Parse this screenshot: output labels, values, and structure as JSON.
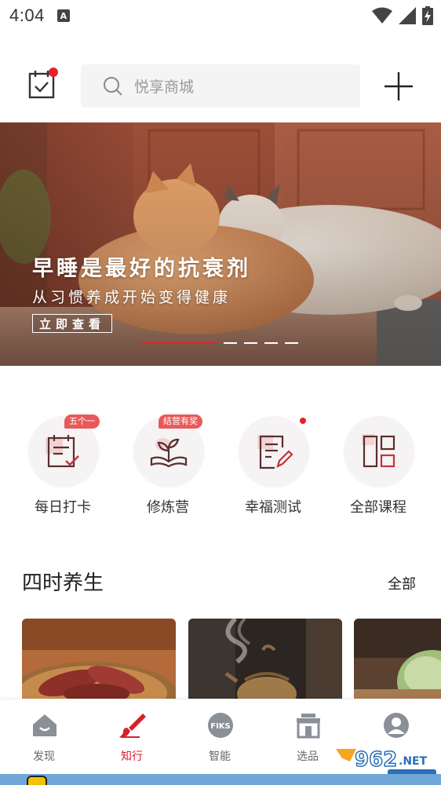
{
  "status_bar": {
    "time": "4:04",
    "notification_icon": "a-icon",
    "icons": [
      "wifi-icon",
      "signal-icon",
      "battery-charging-icon"
    ]
  },
  "top_bar": {
    "calendar_icon": "calendar-check-icon",
    "search_placeholder": "悦享商城",
    "add_icon": "plus-icon"
  },
  "banner": {
    "title": "早睡是最好的抗衰剂",
    "subtitle": "从习惯养成开始变得健康",
    "cta_label": "立即查看",
    "slide_count": 5,
    "active_slide": 1
  },
  "quick_entries": [
    {
      "label": "每日打卡",
      "icon": "calendar-checkin-icon",
      "badge": "五个一",
      "dot": false
    },
    {
      "label": "修炼营",
      "icon": "sprout-book-icon",
      "badge": "结营有奖",
      "dot": false
    },
    {
      "label": "幸福测试",
      "icon": "test-edit-icon",
      "badge": "",
      "dot": true
    },
    {
      "label": "全部课程",
      "icon": "grid-courses-icon",
      "badge": "",
      "dot": false
    }
  ],
  "section": {
    "title": "四时养生",
    "more_label": "全部"
  },
  "bottom_nav": {
    "active_index": 1,
    "items": [
      {
        "label": "发现",
        "icon": "house-icon"
      },
      {
        "label": "知行",
        "icon": "brush-icon"
      },
      {
        "label": "智能",
        "icon": "fiks-icon"
      },
      {
        "label": "选品",
        "icon": "shop-icon"
      },
      {
        "label": "",
        "icon": "user-icon"
      }
    ]
  },
  "colors": {
    "accent": "#e8202a",
    "icon_red": "#c0343a",
    "text_dark": "#222222",
    "search_bg": "#f4f4f4"
  }
}
